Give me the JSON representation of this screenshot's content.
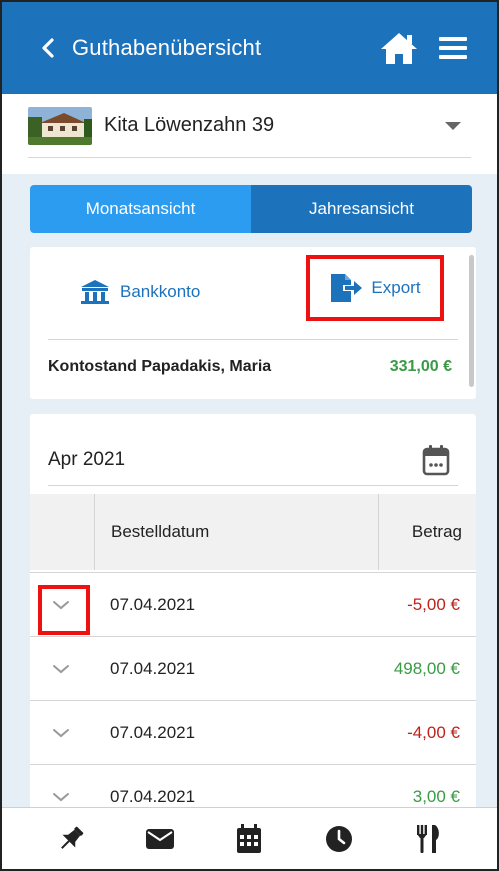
{
  "header": {
    "title": "Guthabenübersicht",
    "back_icon": "chevron-left-icon",
    "home_icon": "home-icon",
    "menu_icon": "hamburger-menu-icon",
    "background": "#1d72bc"
  },
  "facility": {
    "name": "Kita Löwenzahn 39"
  },
  "tabs": [
    {
      "label": "Monatsansicht",
      "active": true
    },
    {
      "label": "Jahresansicht",
      "active": false
    }
  ],
  "account": {
    "bank_label": "Bankkonto",
    "export_label": "Export",
    "balance_label": "Kontostand Papadakis, Maria",
    "balance_value": "331,00 €"
  },
  "transactions": {
    "month": "Apr 2021",
    "columns": {
      "date": "Bestelldatum",
      "amount": "Betrag"
    },
    "rows": [
      {
        "date": "07.04.2021",
        "amount": "-5,00 €",
        "sign": "neg"
      },
      {
        "date": "07.04.2021",
        "amount": "498,00 €",
        "sign": "pos"
      },
      {
        "date": "07.04.2021",
        "amount": "-4,00 €",
        "sign": "neg"
      },
      {
        "date": "07.04.2021",
        "amount": "3,00 €",
        "sign": "pos"
      }
    ]
  },
  "bottom_nav": [
    {
      "icon": "pin-icon"
    },
    {
      "icon": "envelope-icon"
    },
    {
      "icon": "calendar-icon"
    },
    {
      "icon": "clock-icon"
    },
    {
      "icon": "cutlery-icon"
    }
  ],
  "colors": {
    "primary": "#1d72bc",
    "accent": "#2b9cf0",
    "positive": "#3a9a45",
    "negative": "#c0211b",
    "highlight": "#ee1111"
  }
}
